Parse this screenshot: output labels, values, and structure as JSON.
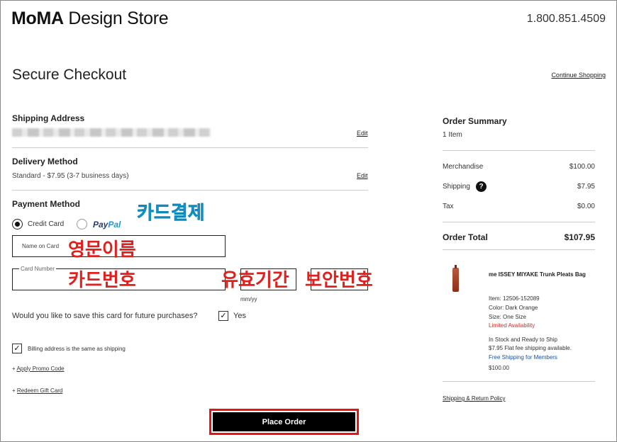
{
  "header": {
    "logo_bold": "MoMA",
    "logo_rest": " Design Store",
    "phone": "1.800.851.4509"
  },
  "checkout": {
    "title": "Secure Checkout",
    "continue_shopping": "Continue Shopping",
    "shipping": {
      "title": "Shipping Address",
      "edit": "Edit"
    },
    "delivery": {
      "title": "Delivery Method",
      "value": "Standard - $7.95 (3-7 business days)",
      "edit": "Edit"
    },
    "payment": {
      "title": "Payment Method",
      "credit_card": "Credit Card",
      "paypal_pay": "Pay",
      "paypal_pal": "Pal",
      "name_on_card_placeholder": "Name on Card",
      "card_number_label": "Card Number",
      "exp_format": "mm/yy",
      "save_question": "Would you like to save this card for future purchases?",
      "save_yes": "Yes",
      "billing_same": "Billing address is the same as shipping",
      "promo": "Apply Promo Code",
      "gift": "Redeem Gift Card"
    },
    "place_order": "Place Order"
  },
  "annotations": {
    "card_payment": "카드결제",
    "english_name": "영문이름",
    "card_number": "카드번호",
    "expiry": "유효기간",
    "security_code": "보안번호"
  },
  "summary": {
    "title": "Order Summary",
    "items": "1 Item",
    "merchandise_label": "Merchandise",
    "merchandise_value": "$100.00",
    "shipping_label": "Shipping",
    "shipping_value": "$7.95",
    "tax_label": "Tax",
    "tax_value": "$0.00",
    "total_label": "Order Total",
    "total_value": "$107.95",
    "product": {
      "name": "me ISSEY MIYAKE Trunk Pleats Bag",
      "item": "Item: 12506-152089",
      "color": "Color: Dark Orange",
      "size": "Size: One Size",
      "availability": "Limited Availability",
      "stock": "In Stock and Ready to Ship",
      "flat_fee": "$7.95 Flat fee shipping available.",
      "free_shipping": "Free Shipping for Members",
      "price": "$100.00"
    },
    "policy": "Shipping & Return Policy"
  }
}
